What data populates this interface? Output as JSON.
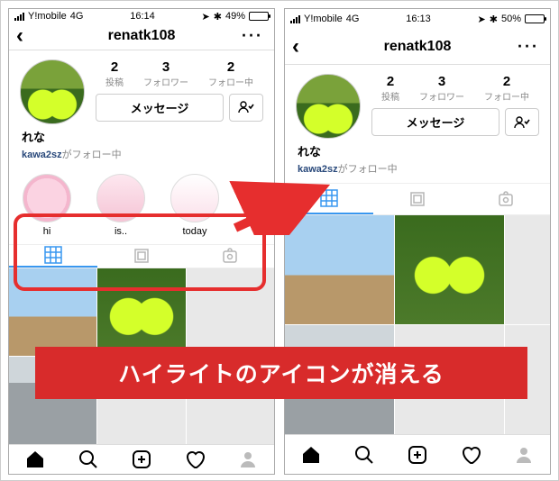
{
  "left": {
    "status": {
      "carrier": "Y!mobile",
      "net": "4G",
      "time": "16:14",
      "batt_pct": "49%",
      "batt_fill": 49
    },
    "header": {
      "username": "renatk108"
    },
    "stats": {
      "posts": {
        "num": "2",
        "lbl": "投稿"
      },
      "followers": {
        "num": "3",
        "lbl": "フォロワー"
      },
      "following": {
        "num": "2",
        "lbl": "フォロー中"
      }
    },
    "buttons": {
      "message": "メッセージ"
    },
    "display_name": "れな",
    "followed_by": {
      "name": "kawa2sz",
      "suffix": "がフォロー中"
    },
    "highlights": [
      {
        "label": "hi"
      },
      {
        "label": "is.."
      },
      {
        "label": "today"
      }
    ]
  },
  "right": {
    "status": {
      "carrier": "Y!mobile",
      "net": "4G",
      "time": "16:13",
      "batt_pct": "50%",
      "batt_fill": 50
    },
    "header": {
      "username": "renatk108"
    },
    "stats": {
      "posts": {
        "num": "2",
        "lbl": "投稿"
      },
      "followers": {
        "num": "3",
        "lbl": "フォロワー"
      },
      "following": {
        "num": "2",
        "lbl": "フォロー中"
      }
    },
    "buttons": {
      "message": "メッセージ"
    },
    "display_name": "れな",
    "followed_by": {
      "name": "kawa2sz",
      "suffix": "がフォロー中"
    }
  },
  "annotation": {
    "banner": "ハイライトのアイコンが消える"
  }
}
